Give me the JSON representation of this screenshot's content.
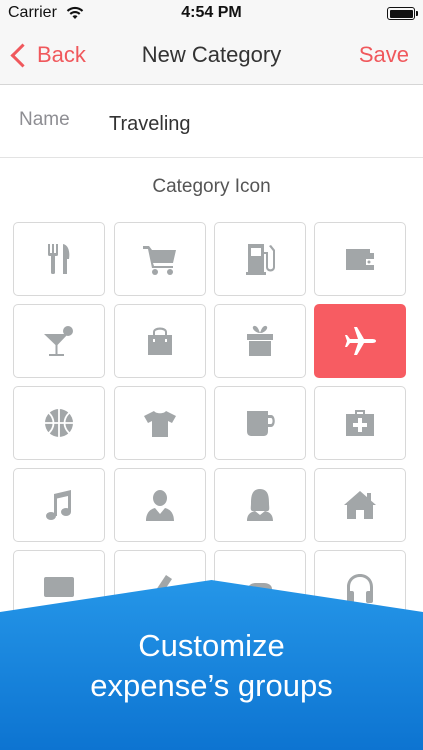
{
  "status_bar": {
    "carrier": "Carrier",
    "time": "4:54 PM"
  },
  "nav": {
    "back_label": "Back",
    "title": "New Category",
    "save_label": "Save"
  },
  "form": {
    "name_label": "Name",
    "name_value": "Traveling"
  },
  "icons_section": {
    "title": "Category Icon",
    "selected": "airplane-icon",
    "icons": [
      "fork-knife-icon",
      "cart-icon",
      "gas-pump-icon",
      "wallet-icon",
      "cocktail-icon",
      "shopping-bag-icon",
      "gift-icon",
      "airplane-icon",
      "basketball-icon",
      "tshirt-icon",
      "mug-icon",
      "first-aid-icon",
      "music-note-icon",
      "man-icon",
      "woman-icon",
      "home-icon",
      "credit-card-icon",
      "ticket-icon",
      "gamepad-icon",
      "headphones-icon"
    ]
  },
  "colors": {
    "accent": "#f0585c",
    "selected_tile": "#f75c62",
    "icon_gray": "#a2a6a8",
    "banner_blue": "#1584df"
  },
  "promo": {
    "line1": "Customize",
    "line2": "expense’s groups"
  }
}
